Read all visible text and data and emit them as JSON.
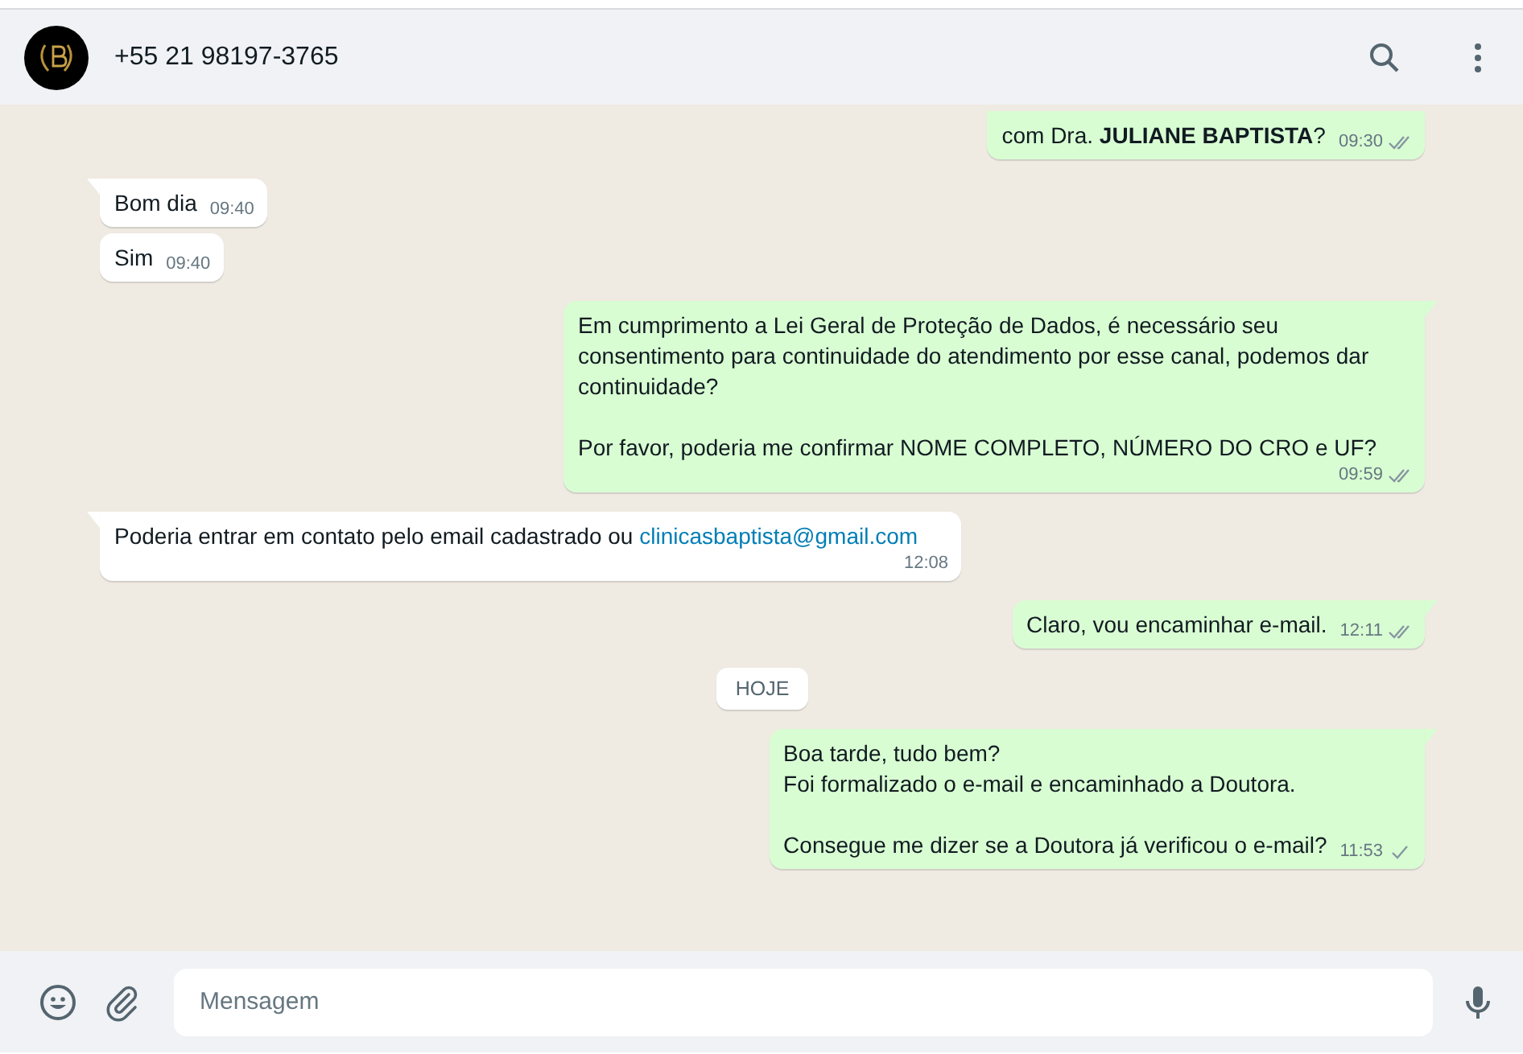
{
  "header": {
    "contact": "+55 21 98197-3765"
  },
  "messages": [
    {
      "kind": "out",
      "tail": false,
      "cut": true,
      "paragraphs": [
        "com Dra. **JULIANE BAPTISTA**?"
      ],
      "time": "09:30",
      "delivered": true
    },
    {
      "kind": "in",
      "tail": true,
      "paragraphs": [
        "Bom dia"
      ],
      "time": "09:40"
    },
    {
      "kind": "in",
      "tail": false,
      "paragraphs": [
        "Sim"
      ],
      "time": "09:40"
    },
    {
      "kind": "out",
      "tail": true,
      "paragraphs": [
        "Em cumprimento a Lei Geral de Proteção de Dados, é necessário seu consentimento para continuidade do atendimento por esse canal, podemos dar continuidade?",
        "Por favor, poderia me confirmar NOME COMPLETO, NÚMERO DO CRO e UF?"
      ],
      "time": "09:59",
      "delivered": true
    },
    {
      "kind": "in",
      "tail": true,
      "paragraphs": [
        "Poderia entrar em contato pelo email cadastrado ou"
      ],
      "link": "clinicasbaptista@gmail.com",
      "time": "12:08"
    },
    {
      "kind": "out",
      "tail": true,
      "paragraphs": [
        "Claro, vou encaminhar e-mail."
      ],
      "time": "12:11",
      "delivered": true
    },
    {
      "kind": "date",
      "label": "HOJE"
    },
    {
      "kind": "out",
      "tail": true,
      "paragraphs": [
        "Boa tarde, tudo bem?\nFoi formalizado o e-mail e encaminhado a Doutora.",
        "Consegue me dizer se a Doutora já verificou o e-mail?"
      ],
      "time": "11:53",
      "delivered": false
    }
  ],
  "composer": {
    "placeholder": "Mensagem"
  }
}
